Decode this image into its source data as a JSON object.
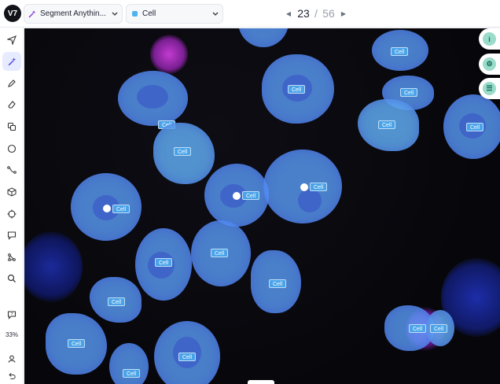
{
  "app": {
    "logo_text": "V7"
  },
  "topbar": {
    "model_dropdown": {
      "label": "Segment Anythin...",
      "icon": "sparkle-wand-icon"
    },
    "class_dropdown": {
      "label": "Cell",
      "swatch_color": "#4fb3f2"
    },
    "pager": {
      "current": "23",
      "separator": "/",
      "total": "56"
    }
  },
  "toolbar": {
    "tools": [
      "cursor-icon",
      "sparkle-wand-icon",
      "pen-icon",
      "eraser-icon",
      "copy-icon",
      "ellipse-icon",
      "polyline-icon",
      "cube-icon",
      "crosshair-icon",
      "comment-icon",
      "graph-icon",
      "search-icon"
    ],
    "bottom_tools": [
      "help-icon",
      "user-icon",
      "undo-icon"
    ],
    "zoom": "33%"
  },
  "canvas": {
    "annotation_label": "Cell",
    "annotation_color": "#4aa3e8",
    "labels": [
      "Cell",
      "Cell",
      "Cell",
      "Cell",
      "Cell",
      "Cell",
      "Cell",
      "Cell",
      "Cell",
      "Cell",
      "Cell",
      "Cell",
      "Cell",
      "Cell",
      "Cell",
      "Cell",
      "Cell",
      "Cell",
      "Cell",
      "Cell"
    ]
  },
  "right_panel": {
    "buttons": [
      {
        "icon": "info-icon",
        "glyph": "i"
      },
      {
        "icon": "settings-icon",
        "glyph": "⚙"
      },
      {
        "icon": "list-icon",
        "glyph": "☰"
      }
    ]
  }
}
